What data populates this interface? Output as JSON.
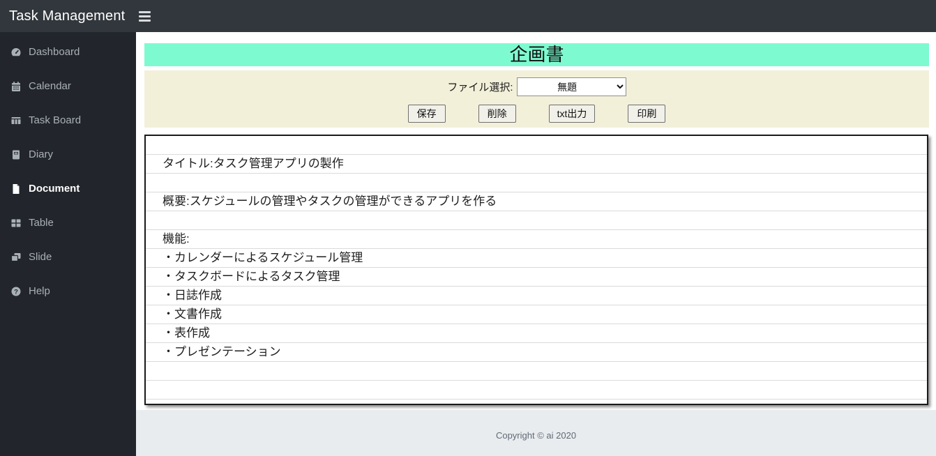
{
  "navbar": {
    "brand": "Task Management",
    "menu_icon": "hamburger-icon"
  },
  "sidebar": {
    "items": [
      {
        "label": "Dashboard",
        "icon": "dashboard-icon",
        "active": false
      },
      {
        "label": "Calendar",
        "icon": "calendar-icon",
        "active": false
      },
      {
        "label": "Task Board",
        "icon": "task-board-icon",
        "active": false
      },
      {
        "label": "Diary",
        "icon": "diary-icon",
        "active": false
      },
      {
        "label": "Document",
        "icon": "document-icon",
        "active": true
      },
      {
        "label": "Table",
        "icon": "table-icon",
        "active": false
      },
      {
        "label": "Slide",
        "icon": "slide-icon",
        "active": false
      },
      {
        "label": "Help",
        "icon": "help-icon",
        "active": false
      }
    ]
  },
  "page": {
    "title": "企画書"
  },
  "toolbar": {
    "file_select_label": "ファイル選択:",
    "file_select_value": "無題",
    "buttons": [
      {
        "label": "保存"
      },
      {
        "label": "削除"
      },
      {
        "label": "txt出力"
      },
      {
        "label": "印刷"
      }
    ]
  },
  "document": {
    "lines": [
      "",
      "タイトル:タスク管理アプリの製作",
      "",
      "概要:スケジュールの管理やタスクの管理ができるアプリを作る",
      "",
      "機能:",
      "・カレンダーによるスケジュール管理",
      "・タスクボードによるタスク管理",
      "・日誌作成",
      "・文書作成",
      "・表作成",
      "・プレゼンテーション",
      "",
      ""
    ]
  },
  "footer": {
    "copyright": "Copyright © ai 2020"
  },
  "colors": {
    "navbar_bg": "#32373d",
    "sidebar_bg": "#22262c",
    "title_bar_bg": "#7efad0",
    "toolbar_bg": "#f3f0da",
    "footer_bg": "#e9ecef",
    "doc_line": "#dadada"
  }
}
